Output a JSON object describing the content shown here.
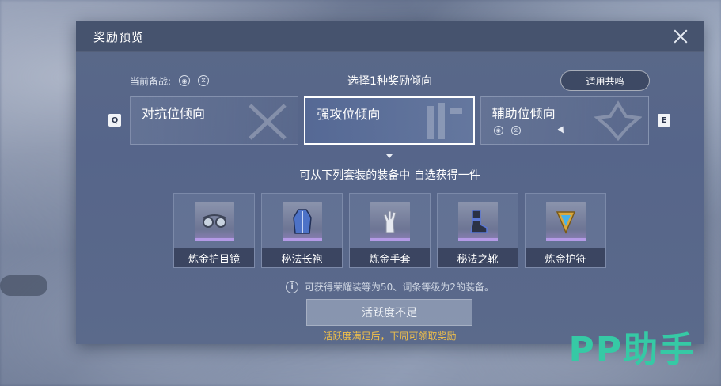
{
  "dialog": {
    "title": "奖励预览",
    "current_label": "当前备战:",
    "select_title": "选择1种奖励倾向",
    "resonance_button": "适用共鸣",
    "keys": {
      "left": "Q",
      "right": "E"
    },
    "tabs": [
      {
        "label": "对抗位倾向",
        "active": false
      },
      {
        "label": "强攻位倾向",
        "active": true
      },
      {
        "label": "辅助位倾向",
        "active": false
      }
    ],
    "subtitle": "可从下列套装的装备中 自选获得一件",
    "items": [
      {
        "name": "炼金护目镜",
        "icon": "goggles-icon"
      },
      {
        "name": "秘法长袍",
        "icon": "robe-icon"
      },
      {
        "name": "炼金手套",
        "icon": "glove-icon"
      },
      {
        "name": "秘法之靴",
        "icon": "boot-icon"
      },
      {
        "name": "炼金护符",
        "icon": "amulet-icon"
      }
    ],
    "info_text": "可获得荣耀装等为50、词条等级为2的装备。",
    "activity_button": "活跃度不足",
    "notice": "活跃度满足后，下周可领取奖励"
  },
  "watermark": "PP助手",
  "colors": {
    "accent": "#f2c14a",
    "watermark": "#36c9a5",
    "item_bar": "#b49ae6"
  }
}
